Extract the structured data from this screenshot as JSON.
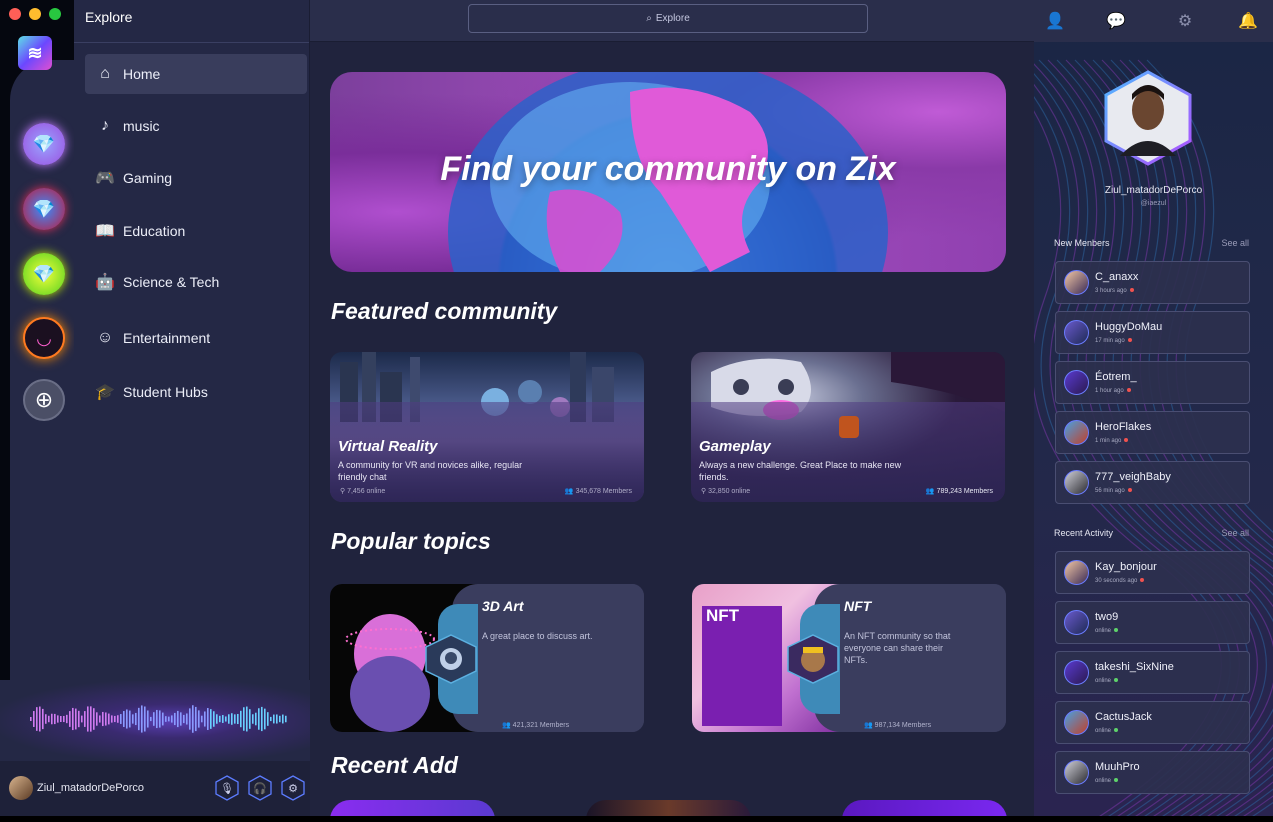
{
  "window": {
    "traffic_lights": [
      "#ff5f57",
      "#febc2e",
      "#28c840"
    ]
  },
  "sidebar": {
    "title": "Explore",
    "items": [
      {
        "label": "Home",
        "icon": "home-icon",
        "active": true
      },
      {
        "label": "music",
        "icon": "music-note-icon"
      },
      {
        "label": "Gaming",
        "icon": "gamepad-icon"
      },
      {
        "label": "Education",
        "icon": "book-icon"
      },
      {
        "label": "Science & Tech",
        "icon": "robot-icon"
      },
      {
        "label": "Entertainment",
        "icon": "smile-icon"
      },
      {
        "label": "Student Hubs",
        "icon": "graduation-cap-icon"
      }
    ]
  },
  "servers": [
    {
      "icon": "diamond-icon",
      "color": "#b45cf0"
    },
    {
      "icon": "diamond-icon",
      "color": "#2a6df0"
    },
    {
      "icon": "diamond-icon",
      "color": "#c6f000"
    },
    {
      "icon": "smiley-icon",
      "color": "#f0a000"
    },
    {
      "icon": "plus-icon",
      "color": "#4b4f66"
    }
  ],
  "user": {
    "name": "Ziul_matadorDePorco",
    "controls": [
      "mic-icon",
      "headphones-icon",
      "settings-icon"
    ]
  },
  "search": {
    "placeholder": "Explore"
  },
  "hero": {
    "title": "Find your community on  Zix"
  },
  "sections": {
    "featured": "Featured community",
    "popular": "Popular topics",
    "recent": "Recent Add"
  },
  "featured": [
    {
      "title": "Virtual Reality",
      "description": "A community for VR and novices alike, regular friendly chat",
      "online": "7,456 online",
      "members": "345,678 Members"
    },
    {
      "title": "Gameplay",
      "description": "Always a new challenge. Great Place to make new friends.",
      "online": "32,850 online",
      "members": "789,243 Members"
    }
  ],
  "topics": [
    {
      "title": "3D Art",
      "description": "A great place to discuss art.",
      "members": "421,321 Members"
    },
    {
      "title": "NFT",
      "description": "An NFT community so that everyone can share their NFTs.",
      "members": "987,134 Members",
      "image_text": "NFT"
    }
  ],
  "right_panel": {
    "top_icons": [
      "user-icon",
      "chat-icon",
      "gear-icon",
      "bell-icon"
    ],
    "profile": {
      "name": "Ziul_matadorDePorco",
      "handle": "@iaezul"
    },
    "new_members": {
      "title": "New Menbers",
      "see_all": "See all",
      "items": [
        {
          "name": "C_anaxx",
          "status": "3 hours ago",
          "dot": "#f0524f"
        },
        {
          "name": "HuggyDoMau",
          "status": "17 min ago",
          "dot": "#f0524f"
        },
        {
          "name": "Éotrem_",
          "status": "1 hour ago",
          "dot": "#f0524f"
        },
        {
          "name": "HeroFlakes",
          "status": "1 min ago",
          "dot": "#f0524f"
        },
        {
          "name": "777_veighBaby",
          "status": "56 min ago",
          "dot": "#f0524f"
        }
      ]
    },
    "recent_activity": {
      "title": "Recent Activity",
      "see_all": "See all",
      "items": [
        {
          "name": "Kay_bonjour",
          "status": "30 seconds  ago",
          "dot": "#f0524f"
        },
        {
          "name": "two9",
          "status": "online",
          "dot": "#5ed36b"
        },
        {
          "name": "takeshi_SixNine",
          "status": "online",
          "dot": "#5ed36b"
        },
        {
          "name": "CactusJack",
          "status": "online",
          "dot": "#5ed36b"
        },
        {
          "name": "MuuhPro",
          "status": "online",
          "dot": "#5ed36b"
        }
      ]
    }
  }
}
